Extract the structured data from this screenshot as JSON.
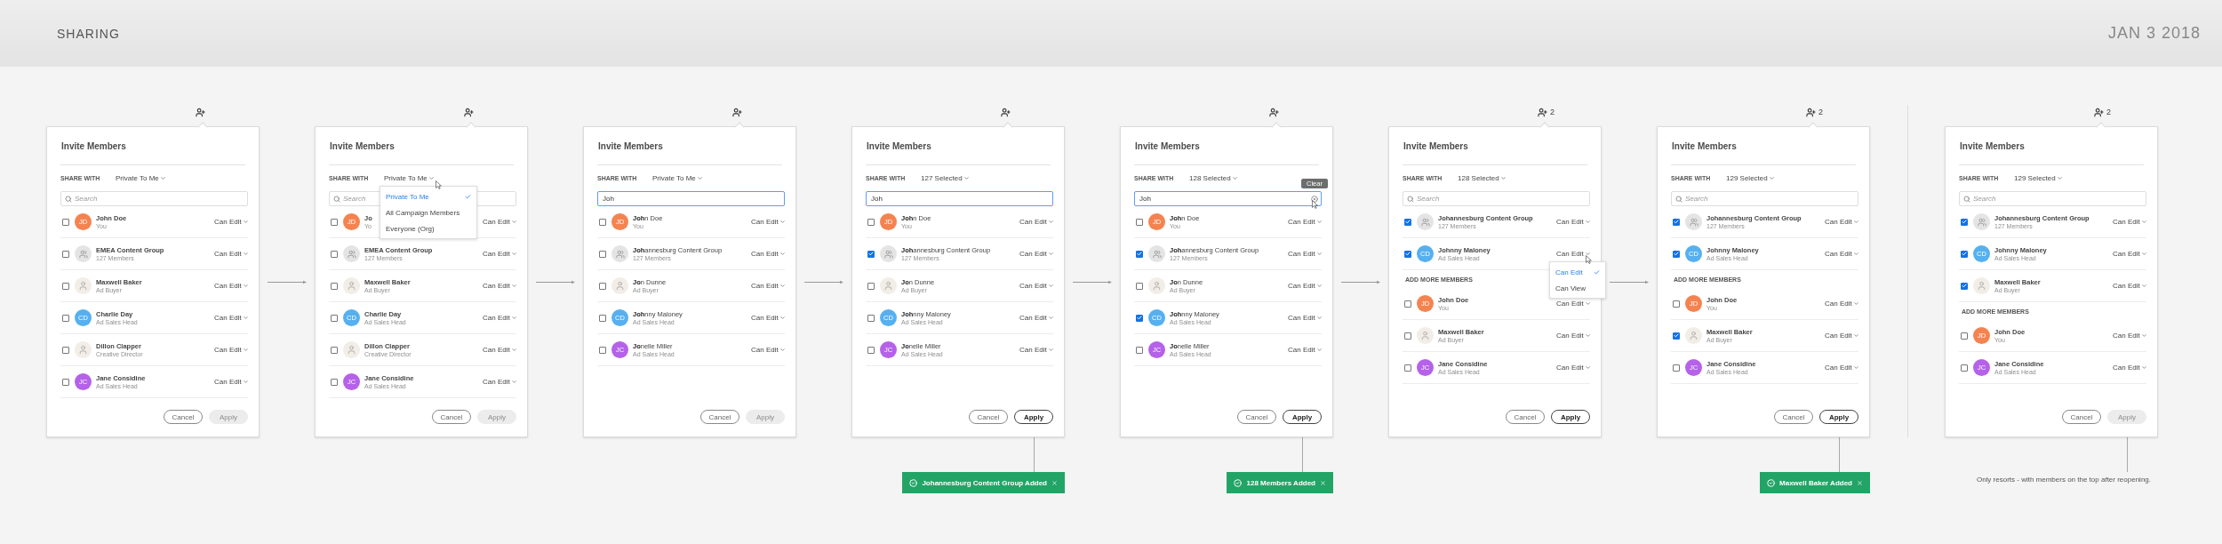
{
  "header": {
    "title": "SHARING",
    "date": "JAN 3 2018"
  },
  "steps": [
    {
      "connector": {
        "kind": "arrow"
      },
      "highlight_matches": false,
      "title": "Invite Members",
      "share_label": "SHARE WITH",
      "share_value": "Private To Me",
      "search": {
        "placeholder": "Search",
        "focused": false
      },
      "sections": [
        {
          "members": [
            {
              "kind": "initials",
              "initials": "JD",
              "color": "#f58350",
              "name": "John Doe",
              "subtitle": "You",
              "checked": false,
              "permission": "Can Edit"
            },
            {
              "kind": "group",
              "name": "EMEA Content Group",
              "subtitle": "127 Members",
              "checked": false,
              "permission": "Can Edit"
            },
            {
              "kind": "photo",
              "name": "Maxwell Baker",
              "subtitle": "Ad Buyer",
              "checked": false,
              "permission": "Can Edit"
            },
            {
              "kind": "initials",
              "initials": "CD",
              "color": "#56b0f0",
              "name": "Charlie Day",
              "subtitle": "Ad Sales Head",
              "checked": false,
              "permission": "Can Edit"
            },
            {
              "kind": "photo",
              "name": "Dillon Clapper",
              "subtitle": "Creative Director",
              "checked": false,
              "permission": "Can Edit"
            },
            {
              "kind": "initials",
              "initials": "JC",
              "color": "#b561e9",
              "name": "Jane Considine",
              "subtitle": "Ad Sales Head",
              "checked": false,
              "permission": "Can Edit"
            }
          ]
        }
      ],
      "buttons": [
        {
          "label": "Cancel",
          "primary": false,
          "disabled": false
        },
        {
          "label": "Apply",
          "primary": true,
          "disabled": true
        }
      ]
    },
    {
      "connector": {
        "kind": "arrow"
      },
      "highlight_matches": false,
      "title": "Invite Members",
      "share_label": "SHARE WITH",
      "share_value": "Private To Me",
      "share_menu": [
        {
          "label": "Private To Me",
          "selected": true
        },
        {
          "label": "All Campaign Members",
          "selected": false
        },
        {
          "label": "Everyone (Org)",
          "selected": false
        }
      ],
      "search": {
        "placeholder": "Search",
        "focused": false
      },
      "sections": [
        {
          "members": [
            {
              "kind": "initials",
              "initials": "JD",
              "color": "#f58350",
              "name": "Jo",
              "subtitle": "Yo",
              "checked": false,
              "permission": "Can Edit"
            },
            {
              "kind": "group",
              "name": "EMEA Content Group",
              "subtitle": "127 Members",
              "checked": false,
              "permission": "Can Edit"
            },
            {
              "kind": "photo",
              "name": "Maxwell Baker",
              "subtitle": "Ad Buyer",
              "checked": false,
              "permission": "Can Edit"
            },
            {
              "kind": "initials",
              "initials": "CD",
              "color": "#56b0f0",
              "name": "Charlie Day",
              "subtitle": "Ad Sales Head",
              "checked": false,
              "permission": "Can Edit"
            },
            {
              "kind": "photo",
              "name": "Dillon Clapper",
              "subtitle": "Creative Director",
              "checked": false,
              "permission": "Can Edit"
            },
            {
              "kind": "initials",
              "initials": "JC",
              "color": "#b561e9",
              "name": "Jane Considine",
              "subtitle": "Ad Sales Head",
              "checked": false,
              "permission": "Can Edit"
            }
          ]
        }
      ],
      "buttons": [
        {
          "label": "Cancel",
          "primary": false,
          "disabled": false
        },
        {
          "label": "Apply",
          "primary": true,
          "disabled": true
        }
      ]
    },
    {
      "connector": {
        "kind": "arrow"
      },
      "highlight_matches": true,
      "title": "Invite Members",
      "share_label": "SHARE WITH",
      "share_value": "Private To Me",
      "search": {
        "value": "Joh",
        "focused": true
      },
      "sections": [
        {
          "members": [
            {
              "kind": "initials",
              "initials": "JD",
              "color": "#f58350",
              "name": "**Joh**n Doe",
              "subtitle": "You",
              "checked": false,
              "permission": "Can Edit"
            },
            {
              "kind": "group",
              "name": "**Joh**annesburg Content Group",
              "subtitle": "127 Members",
              "checked": false,
              "permission": "Can Edit"
            },
            {
              "kind": "photo",
              "name": "**Jo**n Dunne",
              "subtitle": "Ad Buyer",
              "checked": false,
              "permission": "Can Edit"
            },
            {
              "kind": "initials",
              "initials": "CD",
              "color": "#56b0f0",
              "name": "**Joh**nny Maloney",
              "subtitle": "Ad Sales Head",
              "checked": false,
              "permission": "Can Edit"
            },
            {
              "kind": "initials",
              "initials": "JC",
              "color": "#b561e9",
              "name": "**Jo**nelle Miller",
              "subtitle": "Ad Sales Head",
              "checked": false,
              "permission": "Can Edit"
            }
          ]
        }
      ],
      "buttons": [
        {
          "label": "Cancel",
          "primary": false,
          "disabled": false
        },
        {
          "label": "Apply",
          "primary": true,
          "disabled": true
        }
      ]
    },
    {
      "connector": {
        "kind": "arrow"
      },
      "highlight_matches": true,
      "title": "Invite Members",
      "share_label": "SHARE WITH",
      "share_value": "127 Selected",
      "search": {
        "value": "Joh",
        "focused": true
      },
      "sections": [
        {
          "members": [
            {
              "kind": "initials",
              "initials": "JD",
              "color": "#f58350",
              "name": "**Joh**n Doe",
              "subtitle": "You",
              "checked": false,
              "permission": "Can Edit"
            },
            {
              "kind": "group",
              "name": "**Joh**annesburg Content Group",
              "subtitle": "127 Members",
              "checked": true,
              "permission": "Can Edit"
            },
            {
              "kind": "photo",
              "name": "**Jo**n Dunne",
              "subtitle": "Ad Buyer",
              "checked": false,
              "permission": "Can Edit"
            },
            {
              "kind": "initials",
              "initials": "CD",
              "color": "#56b0f0",
              "name": "**Joh**nny Maloney",
              "subtitle": "Ad Sales Head",
              "checked": false,
              "permission": "Can Edit"
            },
            {
              "kind": "initials",
              "initials": "JC",
              "color": "#b561e9",
              "name": "**Jo**nelle Miller",
              "subtitle": "Ad Sales Head",
              "checked": false,
              "permission": "Can Edit"
            }
          ]
        }
      ],
      "buttons": [
        {
          "label": "Cancel",
          "primary": false,
          "disabled": false
        },
        {
          "label": "Apply",
          "primary": true,
          "disabled": false
        }
      ],
      "toast": "Johannesburg Content Group Added"
    },
    {
      "connector": {
        "kind": "arrow"
      },
      "highlight_matches": true,
      "title": "Invite Members",
      "share_label": "SHARE WITH",
      "share_value": "128 Selected",
      "search": {
        "value": "Joh",
        "focused": true,
        "clear_tooltip": "Clear"
      },
      "sections": [
        {
          "members": [
            {
              "kind": "initials",
              "initials": "JD",
              "color": "#f58350",
              "name": "**Joh**n Doe",
              "subtitle": "You",
              "checked": false,
              "permission": "Can Edit"
            },
            {
              "kind": "group",
              "name": "**Joh**annesburg Content Group",
              "subtitle": "127 Members",
              "checked": true,
              "permission": "Can Edit"
            },
            {
              "kind": "photo",
              "name": "**Jo**n Dunne",
              "subtitle": "Ad Buyer",
              "checked": false,
              "permission": "Can Edit"
            },
            {
              "kind": "initials",
              "initials": "CD",
              "color": "#56b0f0",
              "name": "**Joh**nny Maloney",
              "subtitle": "Ad Sales Head",
              "checked": true,
              "permission": "Can Edit"
            },
            {
              "kind": "initials",
              "initials": "JC",
              "color": "#b561e9",
              "name": "**Jo**nelle Miller",
              "subtitle": "Ad Sales Head",
              "checked": false,
              "permission": "Can Edit"
            }
          ]
        }
      ],
      "buttons": [
        {
          "label": "Cancel",
          "primary": false,
          "disabled": false
        },
        {
          "label": "Apply",
          "primary": true,
          "disabled": false
        }
      ],
      "toast": "128 Members Added"
    },
    {
      "connector": {
        "kind": "arrow"
      },
      "badge": "2",
      "highlight_matches": false,
      "title": "Invite Members",
      "share_label": "SHARE WITH",
      "share_value": "128 Selected",
      "search": {
        "placeholder": "Search",
        "focused": false
      },
      "sections": [
        {
          "members": [
            {
              "kind": "group",
              "name": "Johannesburg Content Group",
              "subtitle": "127 Members",
              "checked": true,
              "permission": "Can Edit"
            },
            {
              "kind": "initials",
              "initials": "CD",
              "color": "#56b0f0",
              "name": "Johnny Maloney",
              "subtitle": "Ad Sales Head",
              "checked": true,
              "permission": "Can Edit",
              "menu": [
                {
                  "label": "Can Edit",
                  "selected": true
                },
                {
                  "label": "Can View",
                  "selected": false
                }
              ]
            }
          ]
        },
        {
          "heading": "ADD MORE MEMBERS",
          "members": [
            {
              "kind": "initials",
              "initials": "JD",
              "color": "#f58350",
              "name": "John Doe",
              "subtitle": "You",
              "checked": false,
              "permission": "Can Edit"
            },
            {
              "kind": "photo",
              "name": "Maxwell Baker",
              "subtitle": "Ad Buyer",
              "checked": false,
              "permission": "Can Edit"
            },
            {
              "kind": "initials",
              "initials": "JC",
              "color": "#b561e9",
              "name": "Jane Considine",
              "subtitle": "Ad Sales Head",
              "checked": false,
              "permission": "Can Edit"
            }
          ]
        }
      ],
      "buttons": [
        {
          "label": "Cancel",
          "primary": false,
          "disabled": false
        },
        {
          "label": "Apply",
          "primary": true,
          "disabled": false
        }
      ]
    },
    {
      "connector": {
        "kind": "divider"
      },
      "badge": "2",
      "highlight_matches": false,
      "title": "Invite Members",
      "share_label": "SHARE WITH",
      "share_value": "129 Selected",
      "search": {
        "placeholder": "Search",
        "focused": false
      },
      "sections": [
        {
          "members": [
            {
              "kind": "group",
              "name": "Johannesburg Content Group",
              "subtitle": "127 Members",
              "checked": true,
              "permission": "Can Edit"
            },
            {
              "kind": "initials",
              "initials": "CD",
              "color": "#56b0f0",
              "name": "Johnny Maloney",
              "subtitle": "Ad Sales Head",
              "checked": true,
              "permission": "Can Edit"
            }
          ]
        },
        {
          "heading": "ADD MORE MEMBERS",
          "members": [
            {
              "kind": "initials",
              "initials": "JD",
              "color": "#f58350",
              "name": "John Doe",
              "subtitle": "You",
              "checked": false,
              "permission": "Can Edit"
            },
            {
              "kind": "photo",
              "name": "Maxwell Baker",
              "subtitle": "Ad Buyer",
              "checked": true,
              "permission": "Can Edit"
            },
            {
              "kind": "initials",
              "initials": "JC",
              "color": "#b561e9",
              "name": "Jane Considine",
              "subtitle": "Ad Sales Head",
              "checked": false,
              "permission": "Can Edit"
            }
          ]
        }
      ],
      "buttons": [
        {
          "label": "Cancel",
          "primary": false,
          "disabled": false
        },
        {
          "label": "Apply",
          "primary": true,
          "disabled": false
        }
      ],
      "toast": "Maxwell Baker Added"
    },
    {
      "badge": "2",
      "highlight_matches": false,
      "title": "Invite Members",
      "share_label": "SHARE WITH",
      "share_value": "129 Selected",
      "search": {
        "placeholder": "Search",
        "focused": false
      },
      "sections": [
        {
          "members": [
            {
              "kind": "group",
              "name": "Johannesburg Content Group",
              "subtitle": "127 Members",
              "checked": true,
              "permission": "Can Edit"
            },
            {
              "kind": "initials",
              "initials": "CD",
              "color": "#56b0f0",
              "name": "Johnny Maloney",
              "subtitle": "Ad Sales Head",
              "checked": true,
              "permission": "Can Edit"
            },
            {
              "kind": "photo",
              "name": "Maxwell Baker",
              "subtitle": "Ad Buyer",
              "checked": true,
              "permission": "Can Edit"
            }
          ]
        },
        {
          "heading": "ADD MORE MEMBERS",
          "members": [
            {
              "kind": "initials",
              "initials": "JD",
              "color": "#f58350",
              "name": "John Doe",
              "subtitle": "You",
              "checked": false,
              "permission": "Can Edit"
            },
            {
              "kind": "initials",
              "initials": "JC",
              "color": "#b561e9",
              "name": "Jane Considine",
              "subtitle": "Ad Sales Head",
              "checked": false,
              "permission": "Can Edit"
            }
          ]
        }
      ],
      "buttons": [
        {
          "label": "Cancel",
          "primary": false,
          "disabled": false
        },
        {
          "label": "Apply",
          "primary": true,
          "disabled": true
        }
      ],
      "note": "Only resorts - with members on the top after reopening."
    }
  ]
}
